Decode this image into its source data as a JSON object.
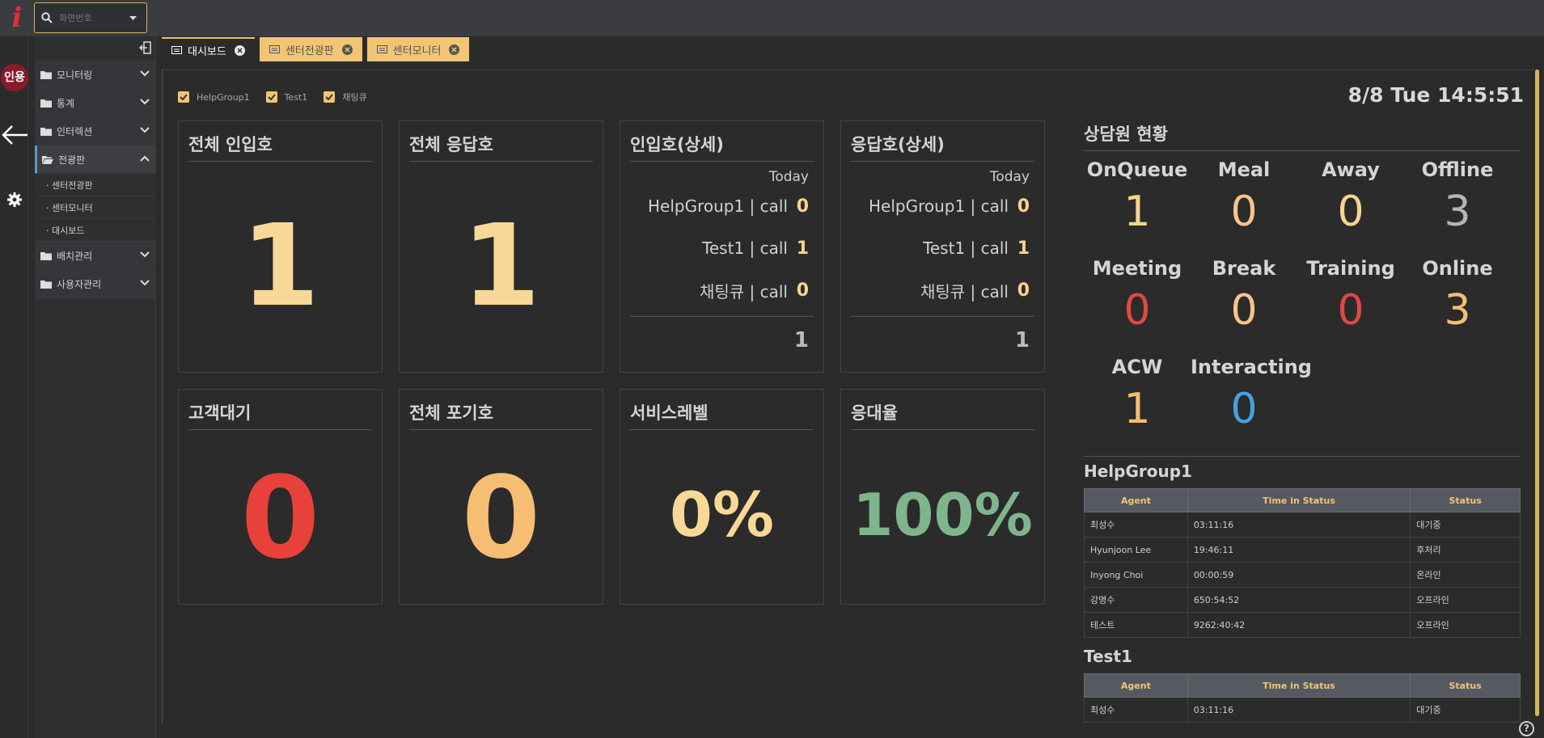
{
  "topbar": {
    "logo": "i",
    "search_placeholder": "화면번호"
  },
  "rail": {
    "avatar": "인용"
  },
  "sidebar": {
    "items": [
      {
        "label": "모니터링"
      },
      {
        "label": "통계"
      },
      {
        "label": "인터렉션"
      },
      {
        "label": "전광판",
        "sub": [
          "· 센터전광판",
          "· 센터모니터",
          "· 대시보드"
        ]
      },
      {
        "label": "배치관리"
      },
      {
        "label": "사용자관리"
      }
    ]
  },
  "tabs": [
    {
      "label": "대시보드"
    },
    {
      "label": "센터전광판"
    },
    {
      "label": "센터모니터"
    }
  ],
  "filters": [
    "HelpGroup1",
    "Test1",
    "채팅큐"
  ],
  "clock": "8/8 Tue 14:5:51",
  "cards": {
    "total_inbound": {
      "title": "전체 인입호",
      "value": "1"
    },
    "total_answered": {
      "title": "전체 응답호",
      "value": "1"
    },
    "inbound_detail": {
      "title": "인입호(상세)",
      "today": "Today",
      "rows": [
        {
          "label": "HelpGroup1 | call",
          "value": "0"
        },
        {
          "label": "Test1 | call",
          "value": "1"
        },
        {
          "label": "채팅큐 | call",
          "value": "0"
        }
      ],
      "total": "1"
    },
    "answered_detail": {
      "title": "응답호(상세)",
      "today": "Today",
      "rows": [
        {
          "label": "HelpGroup1 | call",
          "value": "0"
        },
        {
          "label": "Test1 | call",
          "value": "1"
        },
        {
          "label": "채팅큐 | call",
          "value": "0"
        }
      ],
      "total": "1"
    },
    "waiting": {
      "title": "고객대기",
      "value": "0"
    },
    "total_abandoned": {
      "title": "전체 포기호",
      "value": "0"
    },
    "service_level": {
      "title": "서비스레벨",
      "value": "0%"
    },
    "answer_rate": {
      "title": "응대율",
      "value": "100%"
    }
  },
  "agent_status": {
    "title": "상담원 현황",
    "stats": [
      {
        "label": "OnQueue",
        "value": "1",
        "color": "#f5d48c"
      },
      {
        "label": "Meal",
        "value": "0",
        "color": "#f7c48a"
      },
      {
        "label": "Away",
        "value": "0",
        "color": "#f5d48c"
      },
      {
        "label": "Offline",
        "value": "3",
        "color": "#b5b5b5"
      },
      {
        "label": "Meeting",
        "value": "0",
        "color": "#e04848"
      },
      {
        "label": "Break",
        "value": "0",
        "color": "#f7c48a"
      },
      {
        "label": "Training",
        "value": "0",
        "color": "#e04848"
      },
      {
        "label": "Online",
        "value": "3",
        "color": "#f5be72"
      },
      {
        "label": "ACW",
        "value": "1",
        "color": "#f5be72"
      },
      {
        "label": "Interacting",
        "value": "0",
        "color": "#4aa0dc"
      }
    ]
  },
  "groups": [
    {
      "name": "HelpGroup1",
      "columns": [
        "Agent",
        "Time in Status",
        "Status"
      ],
      "rows": [
        [
          "최성수",
          "03:11:16",
          "대기중"
        ],
        [
          "Hyunjoon Lee",
          "19:46:11",
          "후처리"
        ],
        [
          "Inyong Choi",
          "00:00:59",
          "온라인"
        ],
        [
          "강명수",
          "650:54:52",
          "오프라인"
        ],
        [
          "테스트",
          "9262:40:42",
          "오프라인"
        ]
      ]
    },
    {
      "name": "Test1",
      "columns": [
        "Agent",
        "Time in Status",
        "Status"
      ],
      "rows": [
        [
          "최성수",
          "03:11:16",
          "대기중"
        ]
      ]
    }
  ],
  "colors": {
    "accent": "#f1c574",
    "red": "#e8413b",
    "orange": "#f7bd72",
    "cream": "#f8d896",
    "green": "#7fb58c"
  },
  "help": "?"
}
